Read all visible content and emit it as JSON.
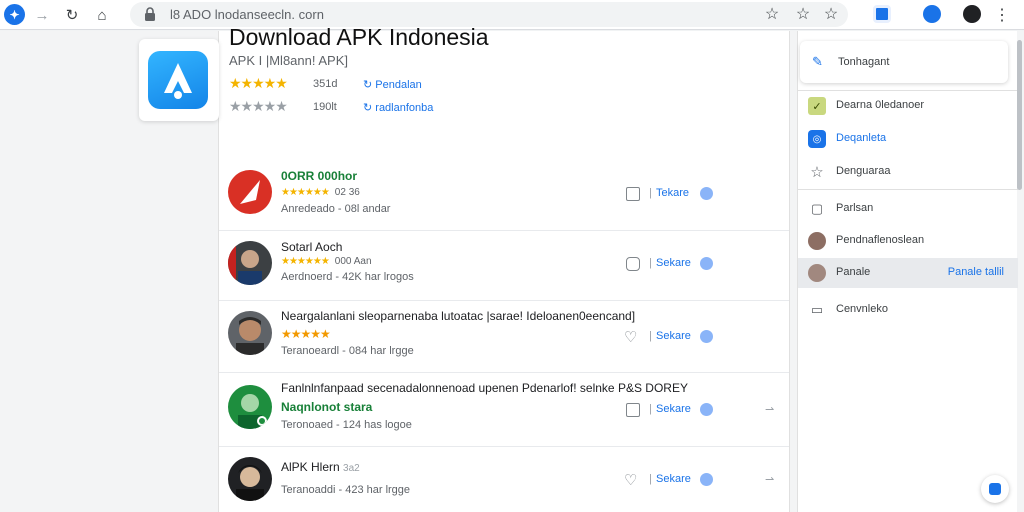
{
  "browser": {
    "url": "l8 ADO lnodanseecln. corn",
    "nav": {
      "back": "←",
      "forward": "→",
      "reload": "↻",
      "home": "⌂"
    },
    "icons": {
      "star": "☆"
    }
  },
  "app": {
    "title": "Download APK Indonesia",
    "subtitle": "APK I |Ml8ann! APK]",
    "rating_count": "351d",
    "downloads": "190lt",
    "link_1": "Pendalan",
    "link_2": "radlanfonba",
    "stars": "★★★★★",
    "stars_gray": "★★★★★"
  },
  "list": [
    {
      "name": "0ORR 000hor",
      "rating": "★★★★★★",
      "rating_count": "02 36",
      "meta": "Anredeado - 08l andar",
      "share": "Tekare",
      "control": "checkbox",
      "name_style": "green"
    },
    {
      "name": "Sotarl Aoch",
      "rating": "★★★★★★",
      "rating_count": "000 Aan",
      "meta": "Aerdnoerd - 42K har lrogos",
      "share": "Sekare",
      "control": "checkbox",
      "name_style": "normal"
    },
    {
      "name": "Neargalanlani sleoparnenaba lutoatac |sarae! Ideloanen0eencand]",
      "rating": "★★★★★",
      "rating_count": "",
      "meta": "Teranoeardl - 084 har lrgge",
      "share": "Sekare",
      "control": "heart",
      "name_style": "normal"
    },
    {
      "name": "Fanlnlnfanpaad secenadalonnenoad upenen Pdenarlof! selnke P&S DOREY",
      "sub_name": "Naqnlonot stara",
      "rating": "",
      "rating_count": "",
      "meta": "Teronoaed - 124 has logoe",
      "share": "Sekare",
      "control": "checkbox",
      "name_style": "normal"
    },
    {
      "name": "AlPK Hlern",
      "rating_count": "3a2",
      "rating": "",
      "meta": "Teranoaddi - 423 har lrgge",
      "share": "Sekare",
      "control": "heart",
      "name_style": "normal"
    }
  ],
  "sidebar": {
    "top_label": "Tonhagant",
    "items": [
      {
        "label": "Dearna 0ledanoer"
      },
      {
        "label": "Deqanleta"
      },
      {
        "label": "Denguaraa"
      },
      {
        "label": "Parlsan"
      },
      {
        "label": "Pendnaflenoslean"
      },
      {
        "label": "Panale",
        "extra": "Panale tallil"
      },
      {
        "label": "Cenvnleko"
      }
    ]
  },
  "colors": {
    "accent": "#1a73e8",
    "star": "#f4b400",
    "green": "#188038"
  }
}
